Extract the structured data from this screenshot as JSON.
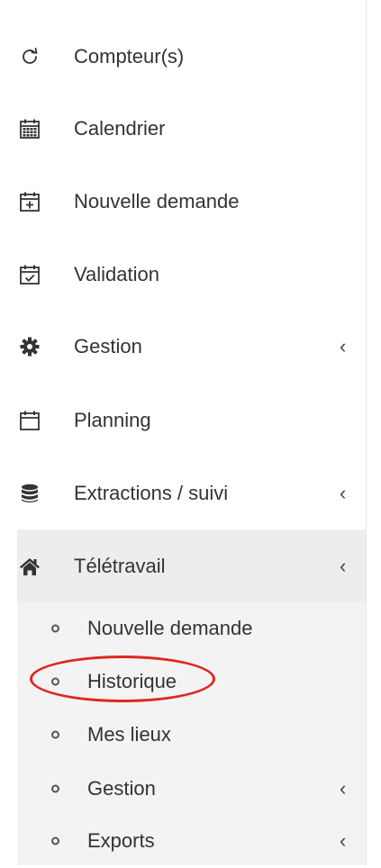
{
  "nav": {
    "items": [
      {
        "label": "Compteur(s)",
        "icon": "refresh-icon",
        "has_chevron": false
      },
      {
        "label": "Calendrier",
        "icon": "calendar-grid-icon",
        "has_chevron": false
      },
      {
        "label": "Nouvelle demande",
        "icon": "calendar-plus-icon",
        "has_chevron": false
      },
      {
        "label": "Validation",
        "icon": "calendar-check-icon",
        "has_chevron": false
      },
      {
        "label": "Gestion",
        "icon": "gear-icon",
        "has_chevron": true
      },
      {
        "label": "Planning",
        "icon": "calendar-empty-icon",
        "has_chevron": false
      },
      {
        "label": "Extractions / suivi",
        "icon": "database-icon",
        "has_chevron": true
      },
      {
        "label": "Télétravail",
        "icon": "home-icon",
        "has_chevron": true,
        "active": true
      }
    ],
    "chevron": "‹"
  },
  "teletravail": {
    "subitems": [
      {
        "label": "Nouvelle demande",
        "has_chevron": false
      },
      {
        "label": "Historique",
        "has_chevron": false,
        "highlighted": true
      },
      {
        "label": "Mes lieux",
        "has_chevron": false
      },
      {
        "label": "Gestion",
        "has_chevron": true
      },
      {
        "label": "Exports",
        "has_chevron": true
      }
    ]
  },
  "colors": {
    "text": "#333333",
    "active_header_bg": "#ededed",
    "submenu_bg": "#f3f3f3",
    "highlight": "#e0271f",
    "icon": "#333333"
  }
}
